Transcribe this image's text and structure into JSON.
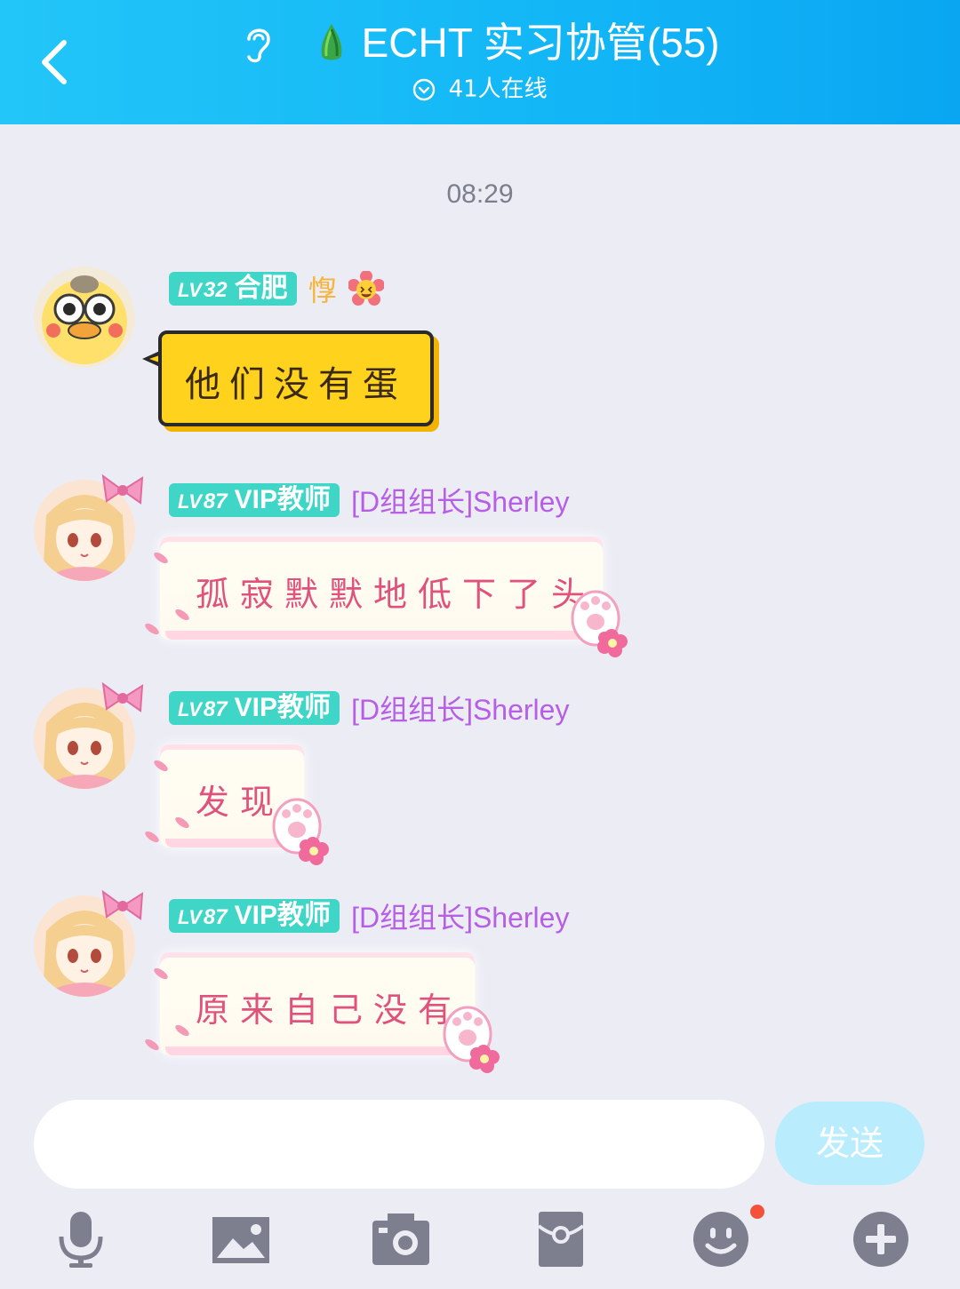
{
  "header": {
    "title": "ECHT 实习协管(55)",
    "online": "41人在线"
  },
  "timestamp": "08:29",
  "messages": [
    {
      "level": "32",
      "level_title": "合肥",
      "nickname": "惸",
      "text": "他们没有蛋",
      "bubble": "yellow"
    },
    {
      "level": "87",
      "level_title": "VIP教师",
      "nickname": "[D组组长]Sherley",
      "text": "孤寂默默地低下了头",
      "bubble": "pink"
    },
    {
      "level": "87",
      "level_title": "VIP教师",
      "nickname": "[D组组长]Sherley",
      "text": "发现",
      "bubble": "pink"
    },
    {
      "level": "87",
      "level_title": "VIP教师",
      "nickname": "[D组组长]Sherley",
      "text": "原来自己没有",
      "bubble": "pink"
    }
  ],
  "input": {
    "placeholder": "",
    "send_label": "发送"
  },
  "toolbar": [
    "microphone-icon",
    "image-icon",
    "camera-icon",
    "red-packet-icon",
    "emoji-icon",
    "plus-icon"
  ],
  "colors": {
    "header": "#12b6f6",
    "level_badge": "#3fd6c7",
    "nick_gold": "#f6b43b",
    "nick_purple": "#b65ee6",
    "send_button": "#b9ecfc",
    "toolbar_icon": "#7d7f8f",
    "notification_dot": "#f4513b"
  }
}
